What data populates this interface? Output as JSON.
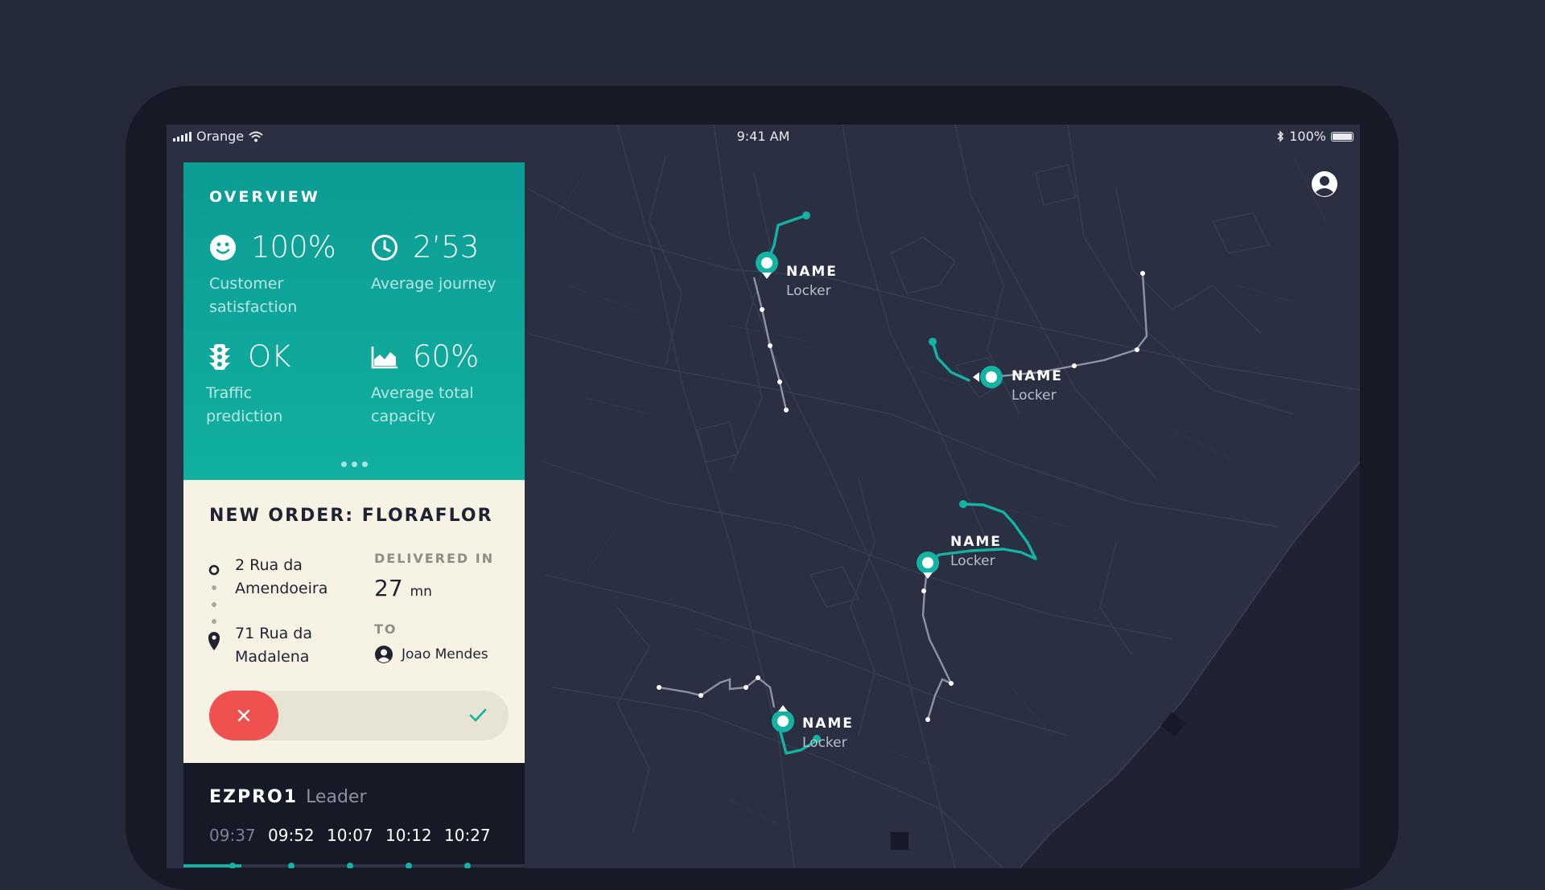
{
  "status_bar": {
    "carrier": "Orange",
    "time": "9:41 AM",
    "battery": "100%"
  },
  "overview": {
    "title": "OVERVIEW",
    "metrics": [
      {
        "icon": "smiley-icon",
        "value": "100%",
        "label_line1": "Customer",
        "label_line2": "satisfaction"
      },
      {
        "icon": "clock-icon",
        "value": "2’53",
        "label_line1": "Average journey",
        "label_line2": ""
      },
      {
        "icon": "traffic-light-icon",
        "value": "OK",
        "label_line1": "Traffic",
        "label_line2": "prediction"
      },
      {
        "icon": "area-chart-icon",
        "value": "60%",
        "label_line1": "Average total",
        "label_line2": "capacity"
      }
    ]
  },
  "order": {
    "title": "NEW ORDER: FLORAFLOR",
    "from_line1": "2 Rua da",
    "from_line2": "Amendoeira",
    "to_line1": "71 Rua da",
    "to_line2": "Madalena",
    "delivered_label": "DELIVERED IN",
    "delivered_value": "27",
    "delivered_unit": "mn",
    "to_label": "TO",
    "recipient": "Joao Mendes"
  },
  "schedule": {
    "name": "EZPRO1",
    "role": "Leader",
    "times": [
      "09:37",
      "09:52",
      "10:07",
      "10:12",
      "10:27"
    ],
    "progress_fraction": 0.17
  },
  "map": {
    "lockers": [
      {
        "name": "NAME",
        "sub": "Locker"
      },
      {
        "name": "NAME",
        "sub": "Locker"
      },
      {
        "name": "NAME",
        "sub": "Locker"
      },
      {
        "name": "NAME",
        "sub": "Locker"
      }
    ]
  },
  "colors": {
    "accent": "#13b3a3",
    "background": "#252a3b",
    "map": "#2a2f41",
    "danger": "#ef5050",
    "order_bg": "#f6f3e4"
  }
}
